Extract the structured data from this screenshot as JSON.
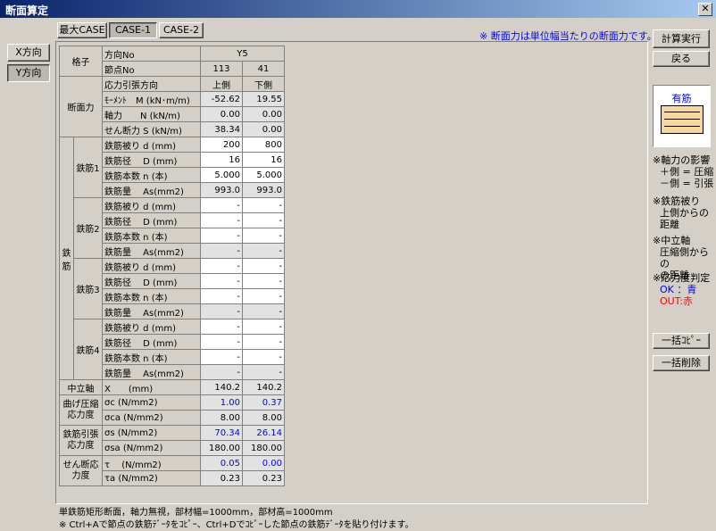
{
  "window": {
    "title": "断面算定",
    "close": "✕"
  },
  "tabs": [
    {
      "label": "最大CASE"
    },
    {
      "label": "CASE-1",
      "active": true
    },
    {
      "label": "CASE-2"
    }
  ],
  "direction": {
    "x": "X方向",
    "y": "Y方向"
  },
  "note_top": "※ 断面力は単位幅当たりの断面力です。",
  "buttons": {
    "calc": "計算実行",
    "back": "戻る",
    "copy_all": "一括ｺﾋﾟｰ",
    "delete_all": "一括削除"
  },
  "table": {
    "kozi": "格子",
    "dir_label": "方向No",
    "dir_value": "Y5",
    "node_label": "節点No",
    "nodes": [
      "113",
      "41"
    ],
    "stress_label": "応力引張方向",
    "stress_dirs": [
      "上側",
      "下側"
    ],
    "section_force": "断面力",
    "moment_label": "ﾓｰﾒﾝﾄ　M (kN･m/m)",
    "moment": [
      "-52.62",
      "19.55"
    ],
    "axial_label": "軸力　　N (kN/m)",
    "axial": [
      "0.00",
      "0.00"
    ],
    "shear_label": "せん断力 S (kN/m)",
    "shear": [
      "38.34",
      "0.00"
    ],
    "rebar": "鉄筋",
    "groups": [
      {
        "name": "鉄筋1",
        "rows": [
          {
            "label": "鉄筋被り d (mm)",
            "v": [
              "200",
              "800"
            ]
          },
          {
            "label": "鉄筋径　 D (mm)",
            "v": [
              "16",
              "16"
            ]
          },
          {
            "label": "鉄筋本数 n (本)",
            "v": [
              "5.000",
              "5.000"
            ]
          },
          {
            "label": "鉄筋量　 As(mm2)",
            "v": [
              "993.0",
              "993.0"
            ]
          }
        ]
      },
      {
        "name": "鉄筋2",
        "rows": [
          {
            "label": "鉄筋被り d (mm)",
            "v": [
              "-",
              "-"
            ]
          },
          {
            "label": "鉄筋径　 D (mm)",
            "v": [
              "-",
              "-"
            ]
          },
          {
            "label": "鉄筋本数 n (本)",
            "v": [
              "-",
              "-"
            ]
          },
          {
            "label": "鉄筋量　 As(mm2)",
            "v": [
              "-",
              "-"
            ]
          }
        ]
      },
      {
        "name": "鉄筋3",
        "rows": [
          {
            "label": "鉄筋被り d (mm)",
            "v": [
              "-",
              "-"
            ]
          },
          {
            "label": "鉄筋径　 D (mm)",
            "v": [
              "-",
              "-"
            ]
          },
          {
            "label": "鉄筋本数 n (本)",
            "v": [
              "-",
              "-"
            ]
          },
          {
            "label": "鉄筋量　 As(mm2)",
            "v": [
              "-",
              "-"
            ]
          }
        ]
      },
      {
        "name": "鉄筋4",
        "rows": [
          {
            "label": "鉄筋被り d (mm)",
            "v": [
              "-",
              "-"
            ]
          },
          {
            "label": "鉄筋径　 D (mm)",
            "v": [
              "-",
              "-"
            ]
          },
          {
            "label": "鉄筋本数 n (本)",
            "v": [
              "-",
              "-"
            ]
          },
          {
            "label": "鉄筋量　 As(mm2)",
            "v": [
              "-",
              "-"
            ]
          }
        ]
      }
    ],
    "neutral": "中立軸",
    "x_label": "X　　(mm)",
    "x": [
      "140.2",
      "140.2"
    ],
    "bend": "曲げ圧縮応力度",
    "sc_label": "σc (N/mm2)",
    "sc": [
      "1.00",
      "0.37"
    ],
    "sca_label": "σca (N/mm2)",
    "sca": [
      "8.00",
      "8.00"
    ],
    "tens": "鉄筋引張応力度",
    "ss_label": "σs (N/mm2)",
    "ss": [
      "70.34",
      "26.14"
    ],
    "ssa_label": "σsa (N/mm2)",
    "ssa": [
      "180.00",
      "180.00"
    ],
    "shear_stress": "せん断応力度",
    "tau_label": "τ　 (N/mm2)",
    "tau": [
      "0.05",
      "0.00"
    ],
    "taua_label": "τa (N/mm2)",
    "taua": [
      "0.23",
      "0.23"
    ]
  },
  "legend": {
    "box_label": "有筋",
    "axial_note": [
      "※軸力の影響",
      "＋側 = 圧縮",
      "－側 = 引張"
    ],
    "cover_note": [
      "※鉄筋被り",
      "上側からの",
      "距離"
    ],
    "neutral_note": [
      "※中立軸",
      "圧縮側からの",
      "の距離"
    ],
    "judge_title": "※応力度判定",
    "ok": "OK ：青",
    "out": "OUT:赤",
    "ok_color": "#0000ff",
    "out_color": "#ff0000"
  },
  "footer": {
    "line1": "単鉄筋矩形断面，軸力無視，部材幅=1000mm，部材高=1000mm",
    "line2": "※ Ctrl+Aで節点の鉄筋ﾃﾞｰﾀをｺﾋﾟｰ、Ctrl+Dでｺﾋﾟｰした節点の鉄筋ﾃﾞｰﾀを貼り付けます。"
  }
}
